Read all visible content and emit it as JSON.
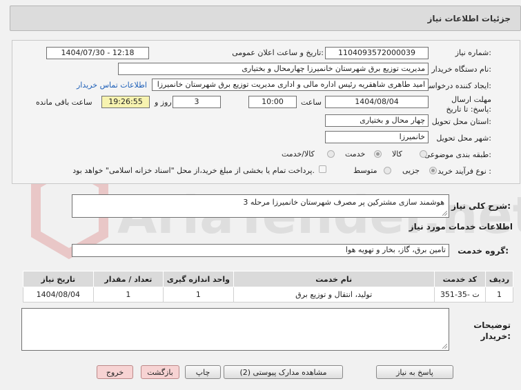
{
  "header": {
    "title": "جزئیات اطلاعات نیاز"
  },
  "form": {
    "need_number_label": "شماره نیاز:",
    "need_number": "1104093572000039",
    "announce_label": "تاریخ و ساعت اعلان عمومی:",
    "announce_value": "1404/07/30 - 12:18",
    "buyer_org_label": "نام دستگاه خریدار:",
    "buyer_org": "مدیریت توزیع برق شهرستان خانمیرزا چهارمحال و بختیاری",
    "creator_label": "ایجاد کننده درخواست:",
    "creator": "امید طاهری شاهقریه رئیس اداره مالی و اداری مدیریت توزیع برق شهرستان خانمیرزا",
    "contact_link": "اطلاعات تماس خریدار",
    "deadline_label": "مهلت ارسال پاسخ: تا تاریخ:",
    "deadline_date": "1404/08/04",
    "time_label": "ساعت",
    "deadline_time": "10:00",
    "days_value": "3",
    "days_label": "روز و",
    "remaining_time": "19:26:55",
    "remaining_label": "ساعت باقی مانده",
    "province_label": "استان محل تحویل:",
    "province": "چهار محال و بختیاری",
    "city_label": "شهر محل تحویل:",
    "city": "خانمیرزا",
    "category_label": "طبقه بندی موضوعی:",
    "category_options": [
      "کالا",
      "خدمت",
      "کالا/خدمت"
    ],
    "process_label": "نوع فرآیند خرید :",
    "process_options": [
      "جزیی",
      "متوسط"
    ],
    "payment_note": "پرداخت تمام یا بخشی از مبلغ خرید،از محل \"اسناد خزانه اسلامی\" خواهد بود."
  },
  "summary": {
    "label": "شرح کلی نیاز:",
    "value": "هوشمند سازی مشترکین پر مصرف شهرستان خانمیرزا مرحله 3"
  },
  "services": {
    "section_title": "اطلاعات خدمات مورد نیاز",
    "group_label": "گروه خدمت:",
    "group_value": "تامین برق، گاز، بخار و تهویه هوا",
    "columns": [
      "ردیف",
      "کد خدمت",
      "نام خدمت",
      "واحد اندازه گیری",
      "تعداد / مقدار",
      "تاریخ نیاز"
    ],
    "rows": [
      [
        "1",
        "ت -35-351",
        "تولید، انتقال و توزیع برق",
        "1",
        "1",
        "1404/08/04"
      ]
    ]
  },
  "notes": {
    "label": "توضیحات خریدار:"
  },
  "buttons": {
    "reply": "پاسخ به نیاز",
    "attachments": "مشاهده مدارک پیوستی (2)",
    "print": "چاپ",
    "back": "بازگشت",
    "exit": "خروج"
  },
  "watermark": {
    "text": "AriaTender.net"
  }
}
